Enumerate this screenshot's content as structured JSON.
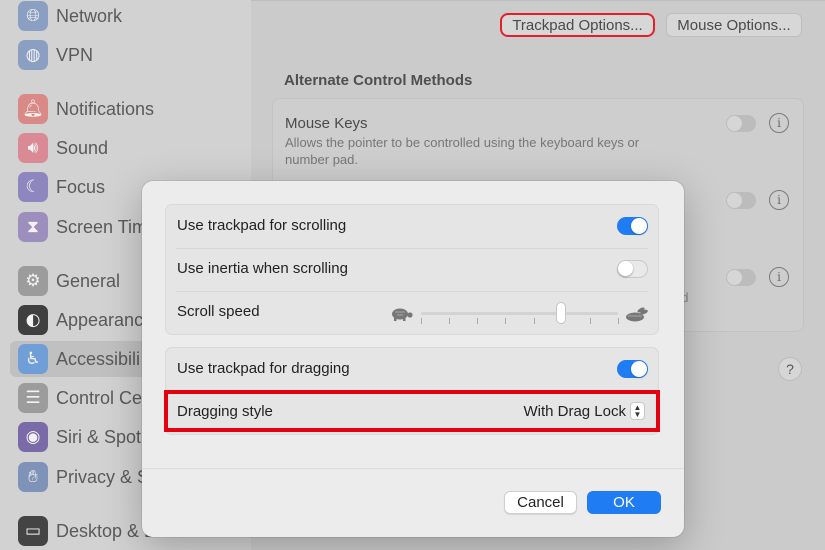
{
  "sidebar": {
    "items": [
      {
        "label": "Network",
        "icon": "globe-icon",
        "color": "#8a9fc2"
      },
      {
        "label": "VPN",
        "icon": "vpn-globe-icon",
        "color": "#8a9fc2"
      },
      {
        "label": "Notifications",
        "icon": "bell-icon",
        "color": "#d98a86"
      },
      {
        "label": "Sound",
        "icon": "speaker-icon",
        "color": "#d98a94"
      },
      {
        "label": "Focus",
        "icon": "moon-icon",
        "color": "#8d86bf"
      },
      {
        "label": "Screen Tim",
        "icon": "hourglass-icon",
        "color": "#9d8fbd"
      },
      {
        "label": "General",
        "icon": "gear-icon",
        "color": "#9c9c9c"
      },
      {
        "label": "Appearanc",
        "icon": "appearance-icon",
        "color": "#3f3f3f"
      },
      {
        "label": "Accessibili",
        "icon": "accessibility-icon",
        "color": "#6f9fd6"
      },
      {
        "label": "Control Cer",
        "icon": "control-center-icon",
        "color": "#9c9c9c"
      },
      {
        "label": "Siri & Spotl",
        "icon": "siri-icon",
        "color": "#7a6aa8"
      },
      {
        "label": "Privacy & S",
        "icon": "hand-icon",
        "color": "#7f93b8"
      },
      {
        "label": "Desktop & D",
        "icon": "dock-icon",
        "color": "#444444"
      }
    ]
  },
  "main": {
    "trackpad_options": "Trackpad Options...",
    "mouse_options": "Mouse Options...",
    "section_title": "Alternate Control Methods",
    "mouse_keys_title": "Mouse Keys",
    "mouse_keys_desc": "Allows the pointer to be controlled using the keyboard keys or number pad.",
    "fragment_text": "ad",
    "info_glyph": "i",
    "help_glyph": "?"
  },
  "dialog": {
    "scroll_group": {
      "use_trackpad_scrolling": {
        "label": "Use trackpad for scrolling",
        "on": true
      },
      "use_inertia": {
        "label": "Use inertia when scrolling",
        "on": false
      },
      "scroll_speed": {
        "label": "Scroll speed",
        "value_fraction": 0.71,
        "tick_count": 8
      }
    },
    "drag_group": {
      "use_trackpad_dragging": {
        "label": "Use trackpad for dragging",
        "on": true
      },
      "dragging_style": {
        "label": "Dragging style",
        "value": "With Drag Lock"
      }
    },
    "cancel_label": "Cancel",
    "ok_label": "OK"
  },
  "colors": {
    "accent": "#1f7cf3",
    "highlight": "#e3000f"
  }
}
